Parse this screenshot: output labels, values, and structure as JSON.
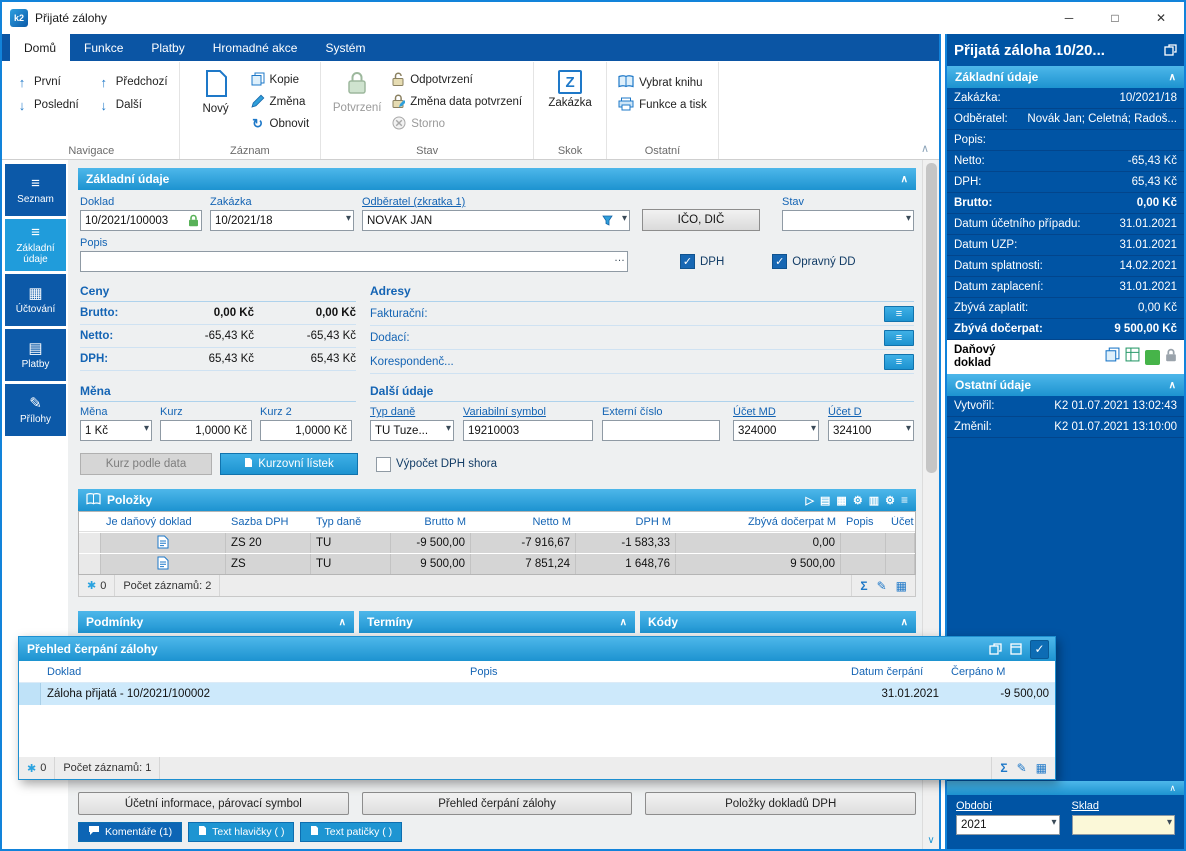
{
  "window": {
    "title": "Přijaté zálohy",
    "controls": {
      "minimize": "─",
      "maximize": "□",
      "close": "✕"
    }
  },
  "icons": {
    "up": "↑",
    "down": "↓",
    "refresh": "↻",
    "chevron_down": "▾",
    "collapse": "∧",
    "expand": "∨",
    "dots": "…",
    "menu": "≡",
    "check": "✓",
    "sum": "Σ",
    "pencil": "✎",
    "grid": "▦",
    "asterisk": "✱",
    "play": "▷",
    "columns": "▥",
    "chart": "▤",
    "gear": "⚙"
  },
  "ribbon": {
    "tabs": [
      "Domů",
      "Funkce",
      "Platby",
      "Hromadné akce",
      "Systém"
    ],
    "navigace": {
      "label": "Navigace",
      "prvni": "První",
      "posledni": "Poslední",
      "predchozi": "Předchozí",
      "dalsi": "Další"
    },
    "zaznam": {
      "label": "Záznam",
      "novy": "Nový",
      "kopie": "Kopie",
      "zmena": "Změna",
      "obnovit": "Obnovit"
    },
    "stav": {
      "label": "Stav",
      "potvrzeni": "Potvrzení",
      "odpotvrzeni": "Odpotvrzení",
      "zmena_data": "Změna data potvrzení",
      "storno": "Storno"
    },
    "skok": {
      "label": "Skok",
      "zakazka": "Zakázka"
    },
    "ostatni": {
      "label": "Ostatní",
      "vybrat_knihu": "Vybrat knihu",
      "funkce_tisk": "Funkce a tisk"
    }
  },
  "sidebar": {
    "items": [
      "Seznam",
      "Základní údaje",
      "Účtování",
      "Platby",
      "Přílohy"
    ]
  },
  "form": {
    "section_title": "Základní údaje",
    "doklad_label": "Doklad",
    "doklad_value": "10/2021/100003",
    "zakazka_label": "Zakázka",
    "zakazka_value": "10/2021/18",
    "odberatel_label": "Odběratel (zkratka 1)",
    "odberatel_value": "NOVÁK JAN",
    "ico_dic_button": "IČO, DIČ",
    "stav_label": "Stav",
    "stav_value": "",
    "popis_label": "Popis",
    "popis_value": "",
    "dph_checkbox": "DPH",
    "opravny_checkbox": "Opravný DD",
    "ceny": {
      "title": "Ceny",
      "rows": [
        {
          "label": "Brutto:",
          "v1": "0,00 Kč",
          "v2": "0,00 Kč"
        },
        {
          "label": "Netto:",
          "v1": "-65,43 Kč",
          "v2": "-65,43 Kč"
        },
        {
          "label": "DPH:",
          "v1": "65,43 Kč",
          "v2": "65,43 Kč"
        }
      ]
    },
    "adresy": {
      "title": "Adresy",
      "rows": [
        "Fakturační:",
        "Dodací:",
        "Korespondenč..."
      ]
    },
    "mena": {
      "title": "Měna",
      "mena_label": "Měna",
      "mena_value": "1 Kč",
      "kurz_label": "Kurz",
      "kurz_value": "1,0000 Kč",
      "kurz2_label": "Kurz 2",
      "kurz2_value": "1,0000 Kč"
    },
    "dalsi": {
      "title": "Další údaje",
      "typ_dane_label": "Typ daně",
      "typ_dane_value": "TU Tuze...",
      "var_symbol_label": "Variabilní symbol",
      "var_symbol_value": "19210003",
      "externi_label": "Externí číslo",
      "externi_value": "",
      "ucet_md_label": "Účet MD",
      "ucet_md_value": "324000",
      "ucet_d_label": "Účet D",
      "ucet_d_value": "324100"
    },
    "kurz_podle_data_button": "Kurz podle data",
    "kurzovni_listek_button": "Kurzovní lístek",
    "vypocet_dph_checkbox": "Výpočet DPH shora"
  },
  "polozky": {
    "title": "Položky",
    "columns": [
      "Je daňový doklad",
      "Sazba DPH",
      "Typ daně",
      "Brutto M",
      "Netto M",
      "DPH M",
      "Zbývá dočerpat M",
      "Popis",
      "Účet"
    ],
    "rows": [
      {
        "sazba": "ZS 20",
        "typ": "TU",
        "brutto": "-9 500,00",
        "netto": "-7 916,67",
        "dph": "-1 583,33",
        "zbyva": "0,00",
        "popis": "",
        "ucet": ""
      },
      {
        "sazba": "ZS",
        "typ": "TU",
        "brutto": "9 500,00",
        "netto": "7 851,24",
        "dph": "1 648,76",
        "zbyva": "9 500,00",
        "popis": "",
        "ucet": ""
      }
    ],
    "status": {
      "badge": "0",
      "count": "Počet záznamů: 2"
    }
  },
  "sections_bottom": [
    "Podmínky",
    "Termíny",
    "Kódy"
  ],
  "dialog": {
    "title": "Přehled čerpání zálohy",
    "columns": [
      "Doklad",
      "Popis",
      "Datum čerpání",
      "Čerpáno M"
    ],
    "rows": [
      {
        "doklad": "Záloha přijatá - 10/2021/100002",
        "popis": "",
        "datum": "31.01.2021",
        "cerpano": "-9 500,00"
      }
    ],
    "status": {
      "badge": "0",
      "count": "Počet záznamů: 1"
    }
  },
  "bottom_buttons": [
    "Účetní informace, párovací symbol",
    "Přehled čerpání zálohy",
    "Položky dokladů DPH"
  ],
  "bottom_tabs": [
    "Komentáře (1)",
    "Text hlavičky ( )",
    "Text patičky ( )"
  ],
  "right_panel": {
    "title": "Přijatá záloha 10/20...",
    "basic": {
      "title": "Základní údaje",
      "rows": [
        {
          "label": "Zakázka:",
          "value": "10/2021/18"
        },
        {
          "label": "Odběratel:",
          "value": "Novák Jan; Celetná; Radoš..."
        },
        {
          "label": "Popis:",
          "value": ""
        },
        {
          "label": "Netto:",
          "value": "-65,43 Kč"
        },
        {
          "label": "DPH:",
          "value": "65,43 Kč"
        },
        {
          "label": "Brutto:",
          "value": "0,00 Kč"
        },
        {
          "label": "Datum účetního případu:",
          "value": "31.01.2021"
        },
        {
          "label": "Datum UZP:",
          "value": "31.01.2021"
        },
        {
          "label": "Datum splatnosti:",
          "value": "14.02.2021"
        },
        {
          "label": "Datum zaplacení:",
          "value": "31.01.2021"
        },
        {
          "label": "Zbývá zaplatit:",
          "value": "0,00 Kč"
        },
        {
          "label": "Zbývá dočerpat:",
          "value": "9 500,00 Kč"
        }
      ],
      "danovy_doklad_label": "Daňový doklad"
    },
    "ostatni": {
      "title": "Ostatní údaje",
      "vytvoril_label": "Vytvořil:",
      "vytvoril_value": "K2 01.07.2021 13:02:43",
      "zmenil_label": "Změnil:",
      "zmenil_value": "K2 01.07.2021 13:10:00"
    },
    "obdobi_label": "Období",
    "obdobi_value": "2021",
    "sklad_label": "Sklad",
    "sklad_value": ""
  }
}
